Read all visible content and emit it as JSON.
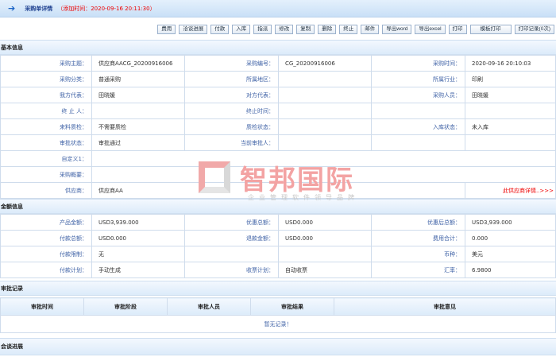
{
  "header": {
    "title": "采购单详情",
    "added_time": "（添加时间：2020-09-16 20:11:30）"
  },
  "toolbar": [
    "费用",
    "洽谈进展",
    "付款",
    "入库",
    "指派",
    "修改",
    "复制",
    "删除",
    "终止",
    "邮件",
    "导出word",
    "导出excel",
    "打印",
    "模板打印",
    "打印记录(0次)"
  ],
  "basic": {
    "title": "基本信息",
    "rows": [
      [
        "采购主题：",
        "供应商AACG_20200916006",
        "采购编号：",
        "CG_20200916006",
        "采购时间：",
        "2020-09-16 20:10:03"
      ],
      [
        "采购分类：",
        "普通采购",
        "所属地区：",
        "",
        "所属行业：",
        "印刷"
      ],
      [
        "我方代表：",
        "田晓媛",
        "对方代表：",
        "",
        "采购人员：",
        "田晓媛"
      ],
      [
        "终 止 人：",
        "",
        "终止时间：",
        "",
        "",
        ""
      ],
      [
        "来料质检：",
        "不需要质检",
        "质检状态：",
        "",
        "入库状态：",
        "未入库"
      ],
      [
        "审批状态：",
        "审批通过",
        "当前审批人：",
        "",
        "",
        ""
      ]
    ],
    "custom1": "自定义1：",
    "summary": "采购概要：",
    "supplier_label": "供应商：",
    "supplier": "供应商AA",
    "supplier_link": "此供应商详情..>>>"
  },
  "amount": {
    "title": "金额信息",
    "rows": [
      [
        "产品金额：",
        "USD3,939.000",
        "优惠总额：",
        "USD0.000",
        "优惠后总额：",
        "USD3,939.000"
      ],
      [
        "付款总额：",
        "USD0.000",
        "退款金额：",
        "USD0.000",
        "费用合计：",
        "0.000"
      ],
      [
        "付款限制：",
        "无",
        "",
        "",
        "币种：",
        "美元"
      ],
      [
        "付款计划：",
        "手动生成",
        "收票计划：",
        "自动收票",
        "汇率：",
        "6.9800"
      ]
    ]
  },
  "approval": {
    "title": "审批记录",
    "columns": [
      "审批时间",
      "审批阶段",
      "审批人员",
      "审批结果",
      "审批意见"
    ],
    "empty": "暂无记录！"
  },
  "progress": {
    "title": "会谈进展"
  },
  "watermark": {
    "name": "智邦国际",
    "slogan": "企业管理软件领导品牌"
  }
}
